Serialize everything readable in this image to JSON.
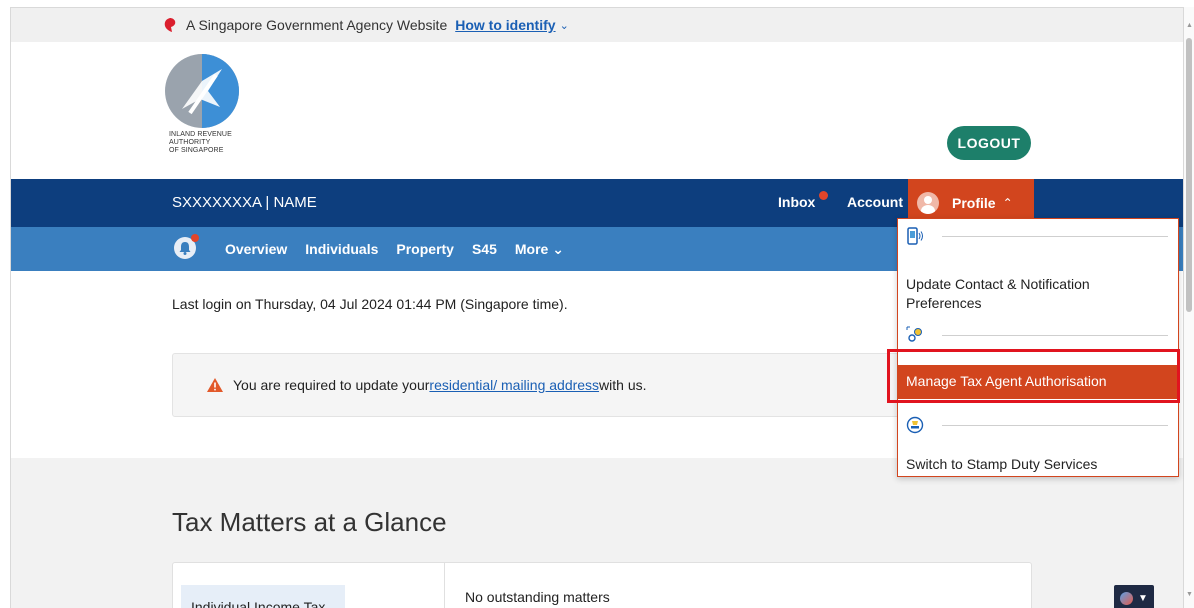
{
  "gov_bar": {
    "text": "A Singapore Government Agency Website",
    "identify_link": "How to identify",
    "chevron": "⌄"
  },
  "header": {
    "logo_lines": [
      "INLAND REVENUE",
      "AUTHORITY",
      "OF SINGAPORE"
    ],
    "logout_label": "LOGOUT"
  },
  "nav1": {
    "user_id": "SXXXXXXXA | NAME",
    "inbox": "Inbox",
    "account": "Account",
    "profile": "Profile",
    "profile_chevron": "⌃"
  },
  "nav2": {
    "items": [
      "Overview",
      "Individuals",
      "Property",
      "S45",
      "More ⌄"
    ]
  },
  "main": {
    "last_login": "Last login on Thursday, 04 Jul 2024 01:44 PM (Singapore time).",
    "alert_prefix": "You are required to update your ",
    "alert_link": "residential/ mailing address",
    "alert_suffix": " with us.",
    "section_title": "Tax Matters at a Glance",
    "tab_label": "Individual Income Tax",
    "no_matters": "No outstanding matters"
  },
  "dropdown": {
    "item1_line1": "Update Contact & Notification",
    "item1_line2": "Preferences",
    "item2": "Manage Tax Agent Authorisation",
    "item3": "Switch to Stamp Duty Services"
  },
  "colors": {
    "navy": "#0d3e7e",
    "light_blue": "#3a7fbf",
    "profile_orange": "#d2451e",
    "logout_green": "#1d7f6a",
    "highlight_red": "#e1141f"
  }
}
